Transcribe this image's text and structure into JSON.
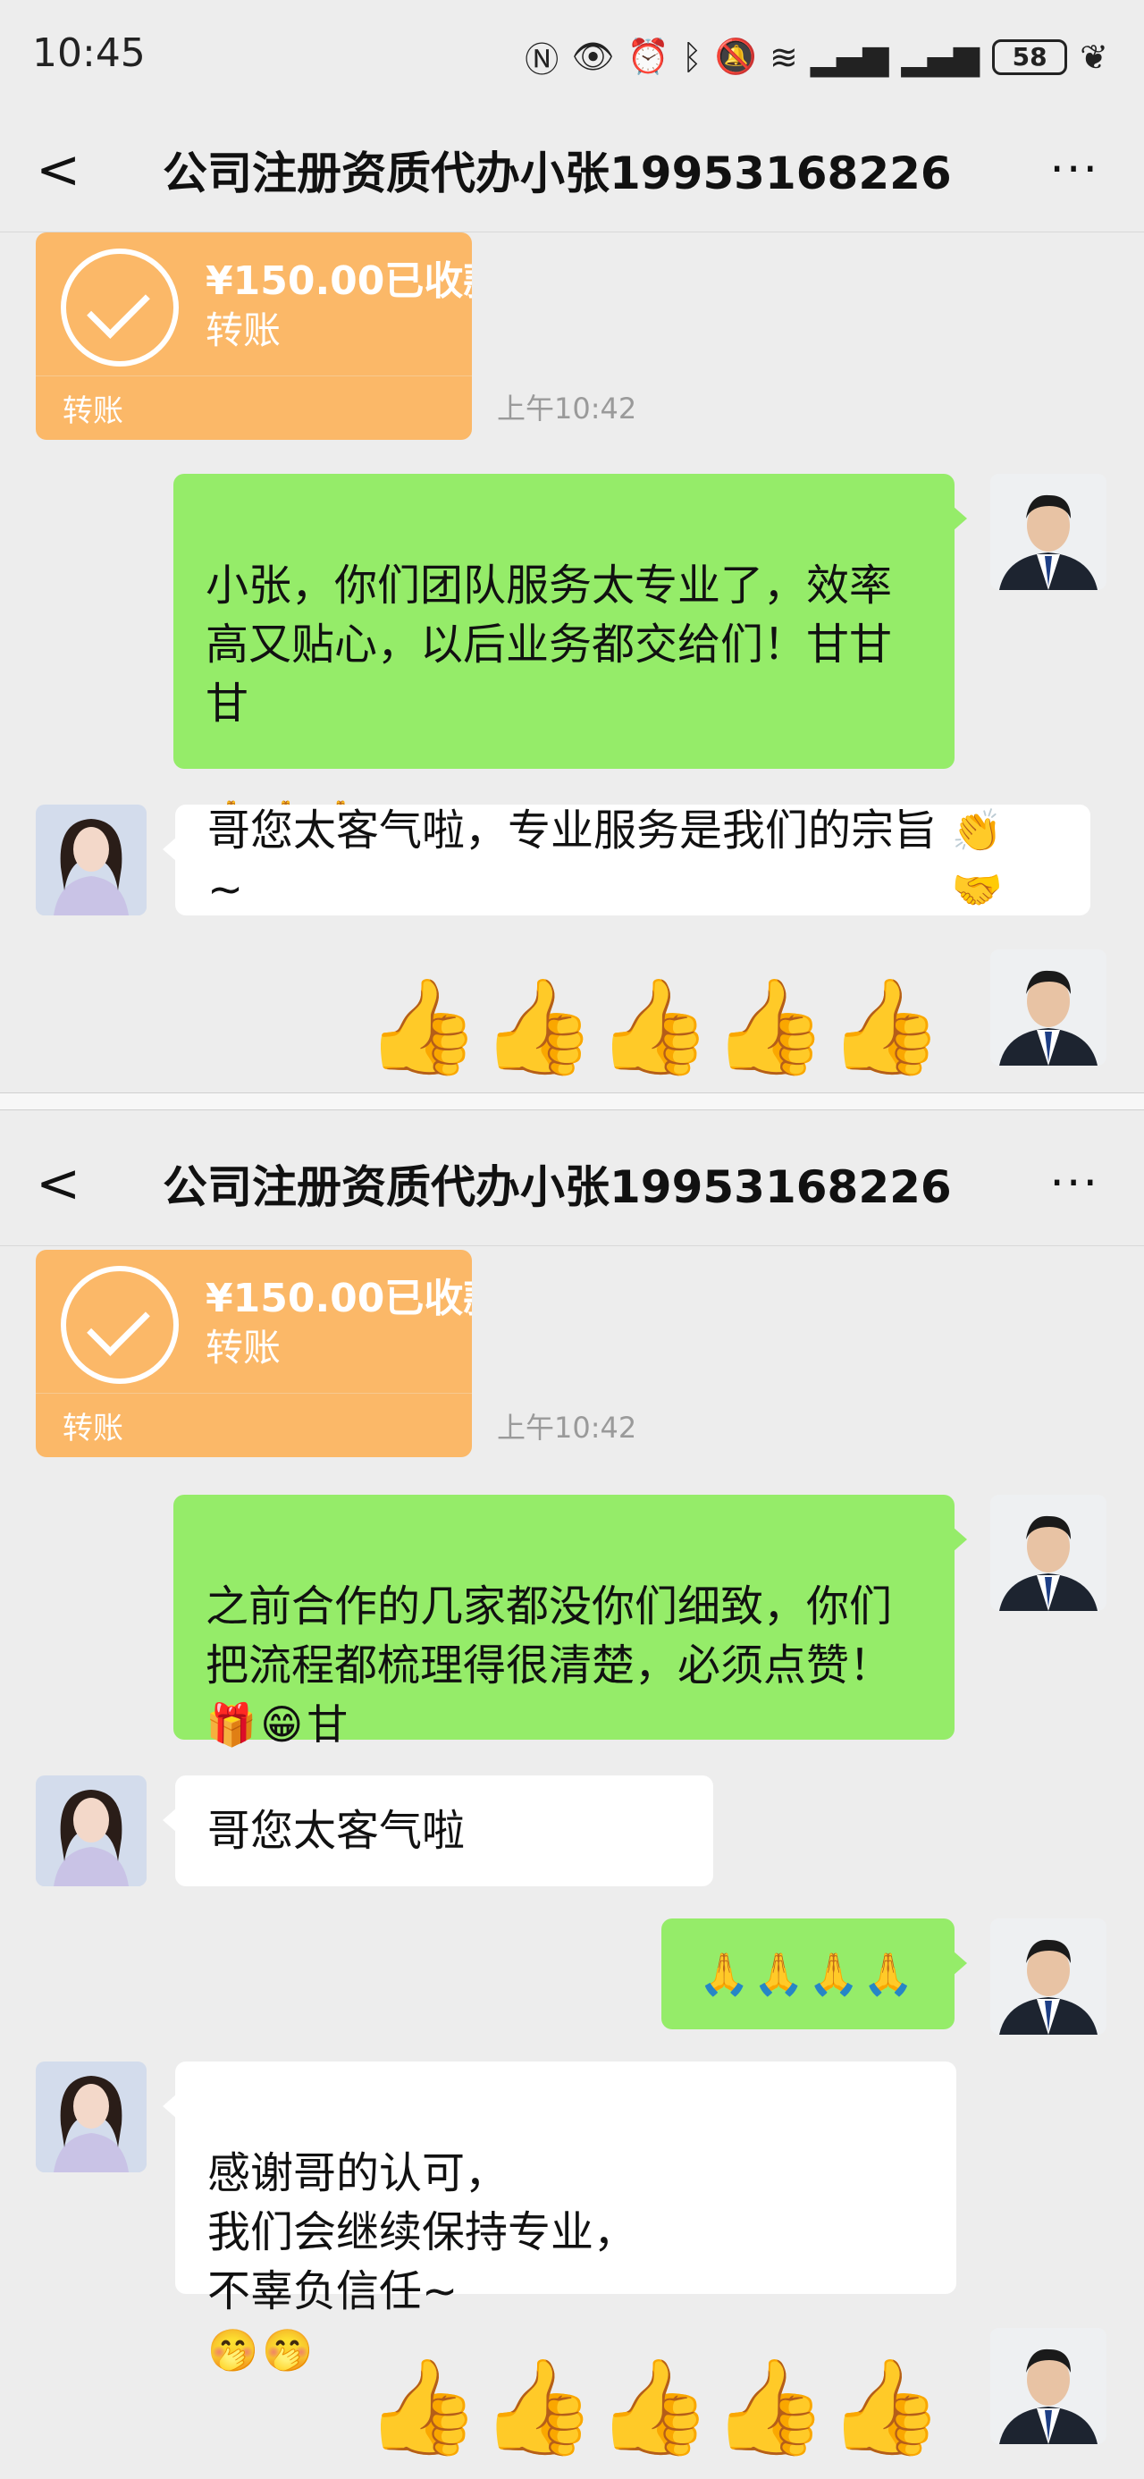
{
  "status": {
    "time": "10:45",
    "battery": "58",
    "icons": [
      "nfc-icon",
      "eye-icon",
      "alarm-icon",
      "bluetooth-icon",
      "mute-icon",
      "wifi-icon",
      "signal-4g-icon",
      "signal-4g-icon",
      "leaf-icon"
    ]
  },
  "panels": [
    {
      "nav": {
        "back": "<",
        "title": "公司注册资质代办小张19953168226",
        "more": "···"
      },
      "transfer": {
        "amount": "¥150.00已收款",
        "label": "转账",
        "footer": "转账",
        "time": "上午10:42"
      },
      "messages": [
        {
          "side": "right",
          "text": "小张，你们团队服务太专业了，效率高又贴心，以后业务都交给们！甘甘甘",
          "emoji": "🙏🙏🙏"
        },
        {
          "side": "left",
          "text": "哥您太客气啦，专业服务是我们的宗旨~",
          "emoji": "👏🤝"
        },
        {
          "side": "right",
          "sticker": "👍👍👍👍👍"
        }
      ]
    },
    {
      "nav": {
        "back": "<",
        "title": "公司注册资质代办小张19953168226",
        "more": "···"
      },
      "transfer": {
        "amount": "¥150.00已收款",
        "label": "转账",
        "footer": "转账",
        "time": "上午10:42"
      },
      "messages": [
        {
          "side": "right",
          "text": "之前合作的几家都没你们细致，你们把流程都梳理得很清楚，必须点赞！",
          "emoji": "🎁😁甘"
        },
        {
          "side": "left",
          "text": "哥您太客气啦"
        },
        {
          "side": "right",
          "emoji": "🙏🙏🙏🙏"
        },
        {
          "side": "left",
          "text": "感谢哥的认可，\n我们会继续保持专业，\n不辜负信任~",
          "emoji": "🤭🤭"
        },
        {
          "side": "right",
          "sticker": "👍👍👍👍👍"
        }
      ]
    }
  ],
  "colors": {
    "background": "#ededed",
    "bubble_self": "#95ec69",
    "bubble_other": "#ffffff",
    "transfer": "#fbb868"
  }
}
